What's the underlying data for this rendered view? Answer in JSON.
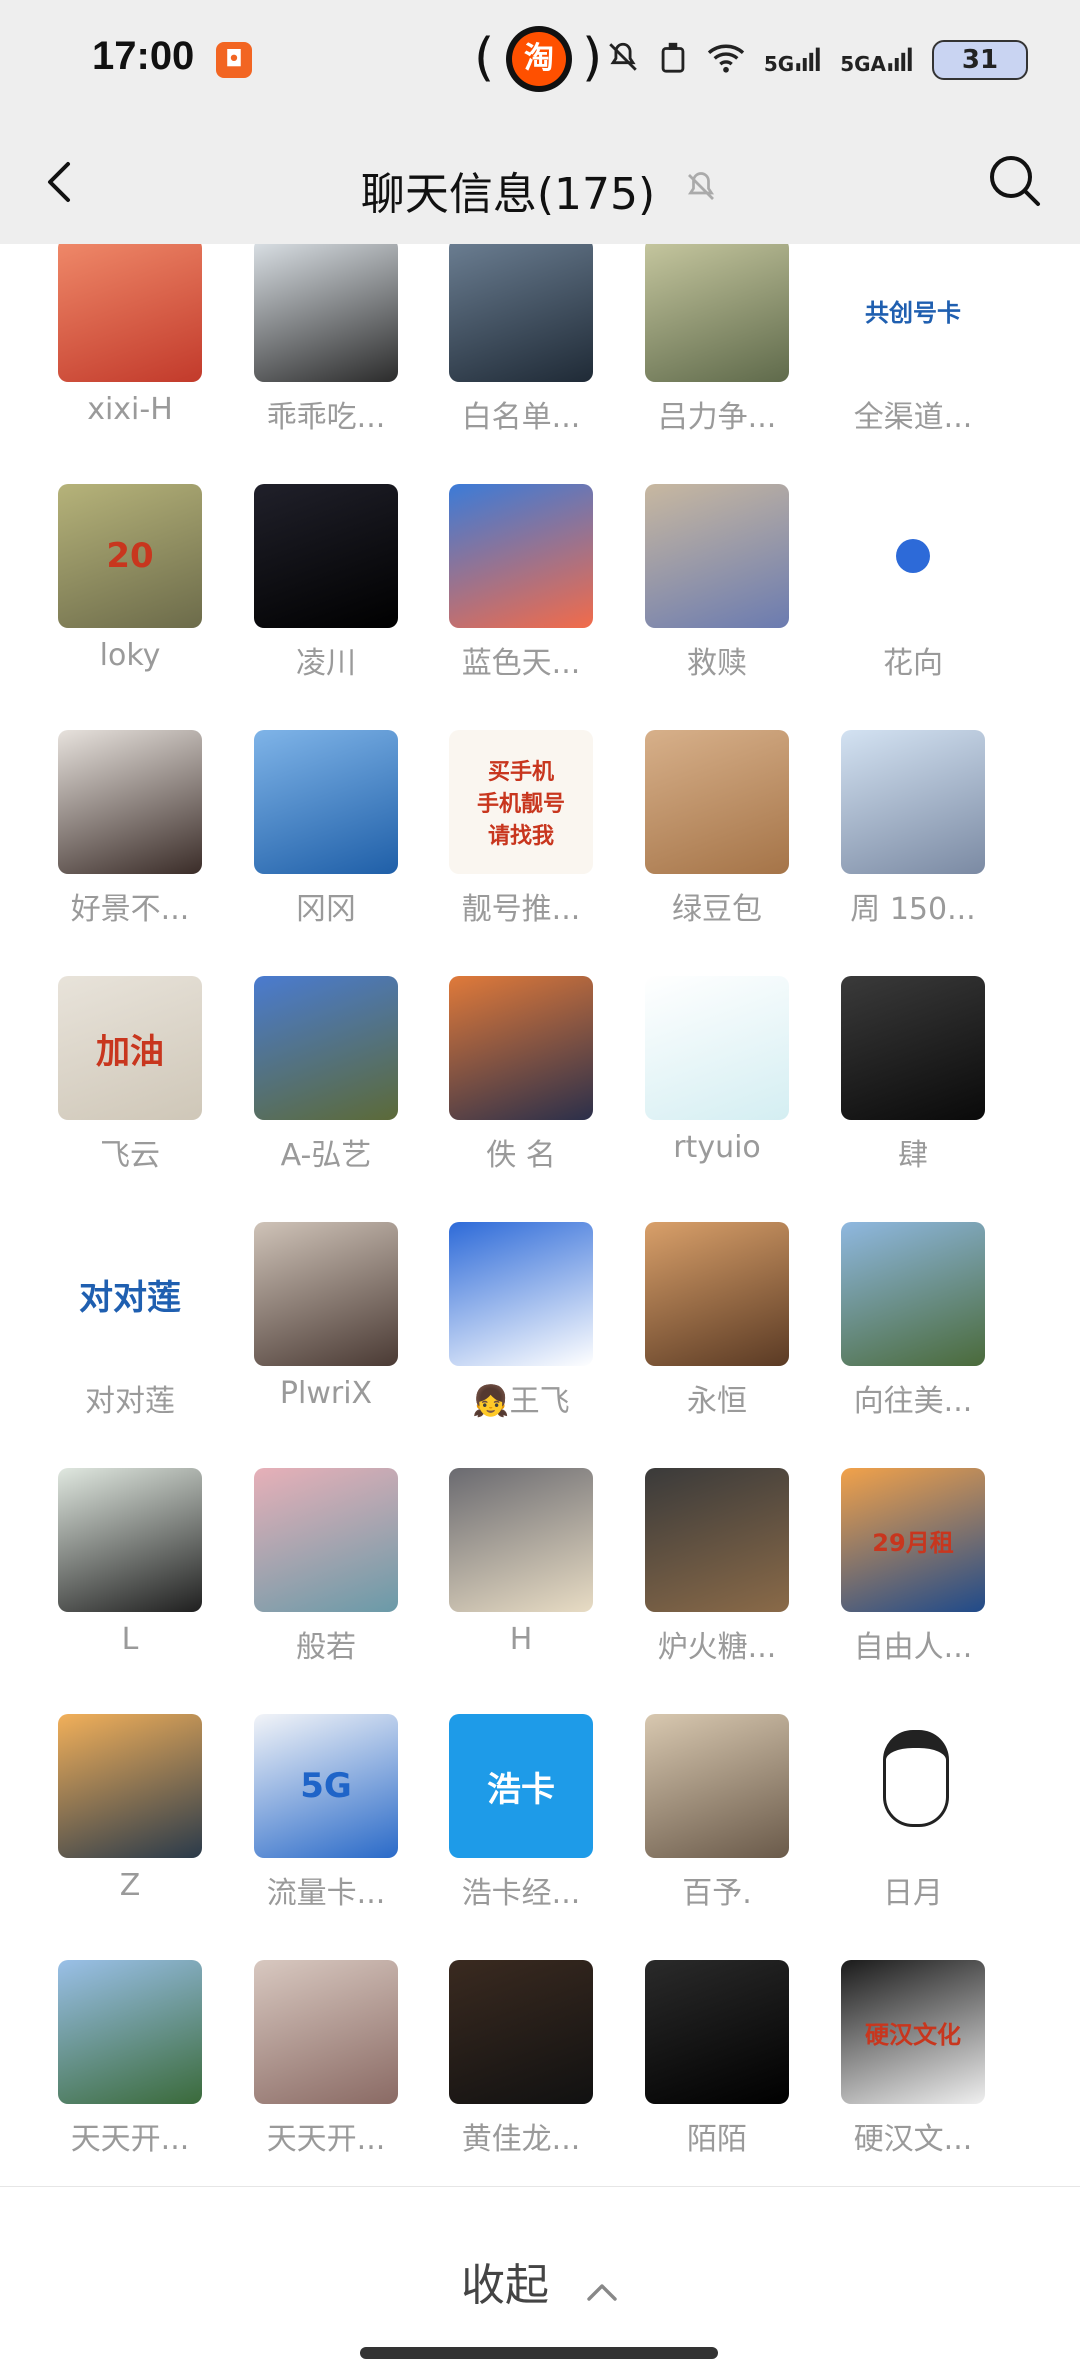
{
  "status_bar": {
    "time": "17:00",
    "app_badge_icon": "app-icon",
    "taobao_label": "淘",
    "signal_5g": "5G",
    "signal_5ga": "5GA",
    "battery": "31"
  },
  "header": {
    "title": "聊天信息(175)"
  },
  "members": [
    {
      "name": "xixi-H",
      "colors": [
        "#f08a6a",
        "#c23a2b"
      ],
      "badge": ""
    },
    {
      "name": "乖乖吃...",
      "colors": [
        "#dde3e8",
        "#2b2b2b"
      ],
      "badge": ""
    },
    {
      "name": "白名单...",
      "colors": [
        "#6c7f93",
        "#1f2a36"
      ],
      "badge": ""
    },
    {
      "name": "吕力争...",
      "colors": [
        "#c7c8a0",
        "#5f6a4b"
      ],
      "badge": ""
    },
    {
      "name": "全渠道...",
      "colors": [
        "#ffffff",
        "#ffffff"
      ],
      "badge": "共创号卡"
    },
    {
      "name": "loky",
      "colors": [
        "#b6b37a",
        "#6c6b4a"
      ],
      "badge": "20"
    },
    {
      "name": "凌川",
      "colors": [
        "#20202a",
        "#000000"
      ],
      "badge": ""
    },
    {
      "name": "蓝色天...",
      "colors": [
        "#3b7bd8",
        "#f26b4a"
      ],
      "badge": ""
    },
    {
      "name": "救赎",
      "colors": [
        "#c8b8a0",
        "#6b7bb0"
      ],
      "badge": ""
    },
    {
      "name": "花向",
      "colors": [
        "#ffffff",
        "#ffffff"
      ],
      "badge": ""
    },
    {
      "name": "好景不...",
      "colors": [
        "#e7e2dd",
        "#3a2c28"
      ],
      "badge": ""
    },
    {
      "name": "冈冈",
      "colors": [
        "#7fb4e8",
        "#1f5fa8"
      ],
      "badge": ""
    },
    {
      "name": "靓号推...",
      "colors": [
        "#faf6f0",
        "#faf6f0"
      ],
      "badge": "买手机\n手机靓号\n请找我"
    },
    {
      "name": "绿豆包",
      "colors": [
        "#d7b08a",
        "#a57448"
      ],
      "badge": ""
    },
    {
      "name": "周 150...",
      "colors": [
        "#d3e2f2",
        "#7b8aa3"
      ],
      "badge": ""
    },
    {
      "name": "飞云",
      "colors": [
        "#e8e3da",
        "#cfc7b8"
      ],
      "badge": "加油"
    },
    {
      "name": "A-弘艺",
      "colors": [
        "#4a7bd0",
        "#5c6a38"
      ],
      "badge": ""
    },
    {
      "name": "佚 名",
      "colors": [
        "#e07a3a",
        "#2b2f4a"
      ],
      "badge": ""
    },
    {
      "name": "rtyuio",
      "colors": [
        "#ffffff",
        "#d4eef2"
      ],
      "badge": ""
    },
    {
      "name": "肆",
      "colors": [
        "#3a3a3a",
        "#0a0a0a"
      ],
      "badge": ""
    },
    {
      "name": "对对莲",
      "colors": [
        "#ffffff",
        "#ffffff"
      ],
      "badge": "对对莲"
    },
    {
      "name": "PlwriX",
      "colors": [
        "#cfc3b8",
        "#4a3a34"
      ],
      "badge": ""
    },
    {
      "name": "👧王飞",
      "colors": [
        "#2d6ad8",
        "#ffffff"
      ],
      "badge": ""
    },
    {
      "name": "永恒",
      "colors": [
        "#d9a06a",
        "#5a3a24"
      ],
      "badge": ""
    },
    {
      "name": "向往美...",
      "colors": [
        "#8fb8e0",
        "#4a6a3a"
      ],
      "badge": ""
    },
    {
      "name": "L",
      "colors": [
        "#e0e8e0",
        "#1f1f1f"
      ],
      "badge": ""
    },
    {
      "name": "般若",
      "colors": [
        "#e7b0b8",
        "#6a9aa8"
      ],
      "badge": ""
    },
    {
      "name": "H",
      "colors": [
        "#6a6a70",
        "#e8dcc4"
      ],
      "badge": ""
    },
    {
      "name": "炉火糖...",
      "colors": [
        "#3a3a3a",
        "#8a6a48"
      ],
      "badge": ""
    },
    {
      "name": "自由人...",
      "colors": [
        "#f2a24a",
        "#1f4a8a"
      ],
      "badge": "29月租"
    },
    {
      "name": "Z",
      "colors": [
        "#f2b05a",
        "#2a3a4a"
      ],
      "badge": ""
    },
    {
      "name": "流量卡...",
      "colors": [
        "#f2f4f8",
        "#2a6ac8"
      ],
      "badge": "5G"
    },
    {
      "name": "浩卡经...",
      "colors": [
        "#1e9be8",
        "#1e9be8"
      ],
      "badge": "浩卡"
    },
    {
      "name": "百予.",
      "colors": [
        "#d8c8b0",
        "#6a5a4a"
      ],
      "badge": ""
    },
    {
      "name": "日月",
      "colors": [
        "#ffffff",
        "#ffffff"
      ],
      "badge": ""
    },
    {
      "name": "天天开...",
      "colors": [
        "#9ac0e8",
        "#3a6a3a"
      ],
      "badge": ""
    },
    {
      "name": "天天开...",
      "colors": [
        "#d8c8c0",
        "#8a6a64"
      ],
      "badge": ""
    },
    {
      "name": "黄佳龙...",
      "colors": [
        "#3a2a20",
        "#111111"
      ],
      "badge": ""
    },
    {
      "name": "陌陌",
      "colors": [
        "#2a2a2a",
        "#000000"
      ],
      "badge": ""
    },
    {
      "name": "硬汉文...",
      "colors": [
        "#1a1a1a",
        "#f0f0f0"
      ],
      "badge": "硬汉文化"
    }
  ],
  "footer": {
    "collapse_label": "收起"
  }
}
